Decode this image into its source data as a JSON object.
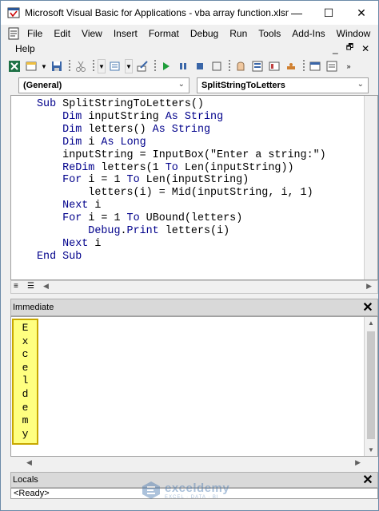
{
  "window": {
    "title": "Microsoft Visual Basic for Applications - vba array function.xlsm - [...",
    "minimize": "—",
    "maximize": "☐",
    "close": "✕"
  },
  "menu": {
    "row1": [
      "File",
      "Edit",
      "View",
      "Insert",
      "Format",
      "Debug",
      "Run",
      "Tools",
      "Add-Ins",
      "Window"
    ],
    "row2": [
      "Help"
    ],
    "mdi_minimize": "_",
    "mdi_restore": "🗗",
    "mdi_close": "✕"
  },
  "combos": {
    "object": "(General)",
    "procedure": "SplitStringToLetters"
  },
  "code": [
    "Sub SplitStringToLetters()",
    "    Dim inputString As String",
    "    Dim letters() As String",
    "    Dim i As Long",
    "    inputString = InputBox(\"Enter a string:\")",
    "    ReDim letters(1 To Len(inputString))",
    "    For i = 1 To Len(inputString)",
    "        letters(i) = Mid(inputString, i, 1)",
    "    Next i",
    "    For i = 1 To UBound(letters)",
    "        Debug.Print letters(i)",
    "    Next i",
    "End Sub"
  ],
  "immediate": {
    "title": "Immediate",
    "output": [
      "E",
      "x",
      "c",
      "e",
      "l",
      "d",
      "e",
      "m",
      "y"
    ]
  },
  "locals": {
    "title": "Locals",
    "status": "<Ready>"
  },
  "watermark": {
    "name": "exceldemy",
    "tagline": "EXCEL · DATA · BI"
  },
  "colors": {
    "keyword": "#00008b",
    "highlight": "#ffff80",
    "highlight_border": "#c8a800"
  }
}
